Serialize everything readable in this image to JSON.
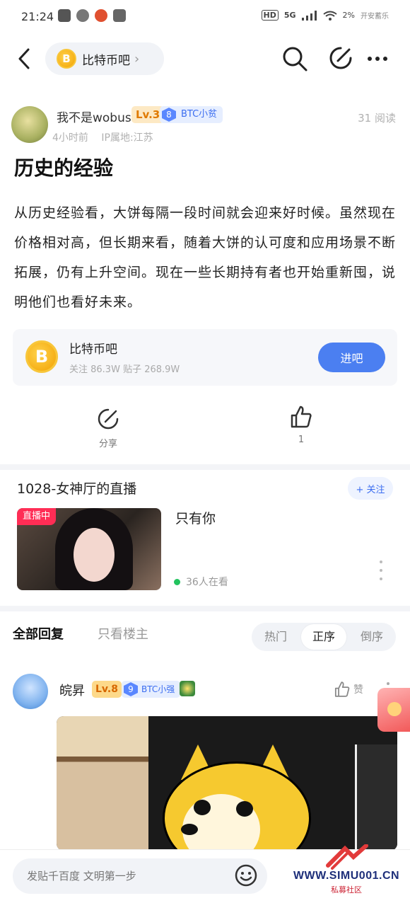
{
  "status_bar": {
    "time": "21:24",
    "signal_label": "5G",
    "battery": "2%",
    "carrier_note": "开安蓄乐"
  },
  "nav": {
    "forum_name": "比特币吧",
    "coin_symbol": "B"
  },
  "post": {
    "author": {
      "name": "我不是wobus",
      "level": "Lv.3",
      "tag_num": "8",
      "tag": "BTC小贫",
      "time": "4小时前",
      "ip": "IP属地:江苏"
    },
    "read_count": "31 阅读",
    "title": "历史的经验",
    "body": "从历史经验看，大饼每隔一段时间就会迎来好时候。虽然现在价格相对高，但长期来看，随着大饼的认可度和应用场景不断拓展，仍有上升空间。现在一些长期持有者也开始重新囤，说明他们也看好未来。"
  },
  "forum_card": {
    "coin_symbol": "B",
    "name": "比特币吧",
    "stats": "关注 86.3W  贴子 268.9W",
    "enter_label": "进吧"
  },
  "actions": {
    "share_label": "分享",
    "like_count": "1"
  },
  "live": {
    "title": "1028-女神厅的直播",
    "follow_label": "+ 关注",
    "badge": "直播中",
    "caption": "只有你",
    "viewers": "36人在看"
  },
  "replies_header": {
    "tab_all": "全部回复",
    "tab_op": "只看楼主",
    "sort_hot": "热门",
    "sort_asc": "正序",
    "sort_desc": "倒序",
    "active_sort": "正序"
  },
  "reply": {
    "name": "皖昇",
    "level": "Lv.8",
    "tag_num": "9",
    "tag": "BTC小强",
    "like_label": "赞"
  },
  "bottom": {
    "input_placeholder": "发贴千百度 文明第一步",
    "watermark": "WWW.SIMU001.CN",
    "watermark_sub": "私募社区"
  },
  "colors": {
    "accent": "#4b7ff1",
    "live_badge": "#ff2d55",
    "level_badge": "#fde9c4",
    "online_dot": "#22c35e"
  }
}
